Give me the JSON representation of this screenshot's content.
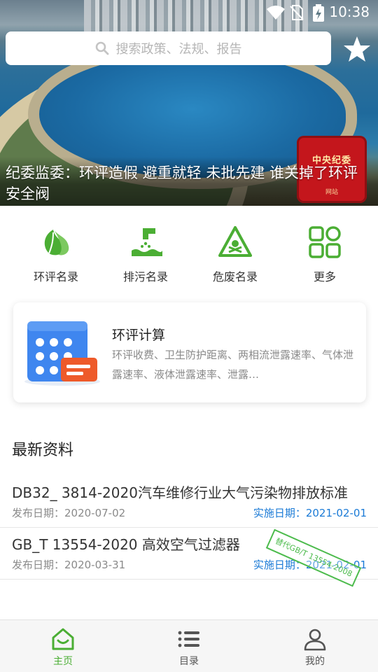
{
  "status_bar": {
    "time": "10:38",
    "icons": [
      "wifi-icon",
      "no-sim-icon",
      "battery-charging-icon"
    ]
  },
  "search": {
    "placeholder": "搜索政策、法规、报告",
    "icon": "search-icon"
  },
  "favorite": {
    "icon": "star-icon"
  },
  "banner": {
    "title": "纪委监委：环评造假 避重就轻 未批先建 谁关掉了环评安全阀",
    "seal_text": "中央纪委",
    "seal_sub": "网站"
  },
  "categories": [
    {
      "label": "环评名录",
      "icon": "leaf-icon"
    },
    {
      "label": "排污名录",
      "icon": "discharge-pipe-icon"
    },
    {
      "label": "危废名录",
      "icon": "hazard-icon"
    },
    {
      "label": "更多",
      "icon": "grid-icon"
    }
  ],
  "calc_card": {
    "title": "环评计算",
    "description": "环评收费、卫生防护距离、两相流泄露速率、气体泄露速率、液体泄露速率、泄露…",
    "icon": "calculator-icon"
  },
  "latest": {
    "title": "最新资料",
    "items": [
      {
        "title": "DB32_ 3814-2020汽车维修行业大气污染物排放标准",
        "publish": "发布日期：2020-07-02",
        "implement": "实施日期：2021-02-01"
      },
      {
        "title": "GB_T 13554-2020 高效空气过滤器",
        "publish": "发布日期：2020-03-31",
        "implement": "实施日期：2021-02-01",
        "stamp": "替代GB/T 13554-2008"
      }
    ]
  },
  "bottom_nav": [
    {
      "label": "主页",
      "icon": "home-icon",
      "active": true
    },
    {
      "label": "目录",
      "icon": "list-icon",
      "active": false
    },
    {
      "label": "我的",
      "icon": "profile-icon",
      "active": false
    }
  ],
  "colors": {
    "accent_green": "#4bae34",
    "link_blue": "#1a7ad6",
    "seal_red": "#c4161c"
  }
}
